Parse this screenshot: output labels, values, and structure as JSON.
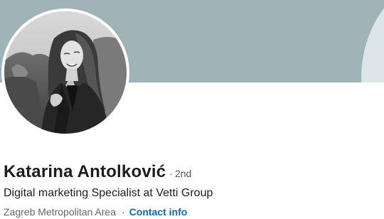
{
  "profile": {
    "name": "Katarina Antolković",
    "degree_separator": "·",
    "degree": "2nd",
    "headline": "Digital marketing Specialist at Vetti Group",
    "location": "Zagreb Metropolitan Area",
    "location_separator": "·",
    "contact_info_label": "Contact info"
  },
  "colors": {
    "cover": "#a0b4b7",
    "link": "#0a66c2",
    "name_text": "#1d1d1d",
    "secondary_text": "#666666"
  },
  "icons": {
    "avatar": "profile-photo"
  }
}
